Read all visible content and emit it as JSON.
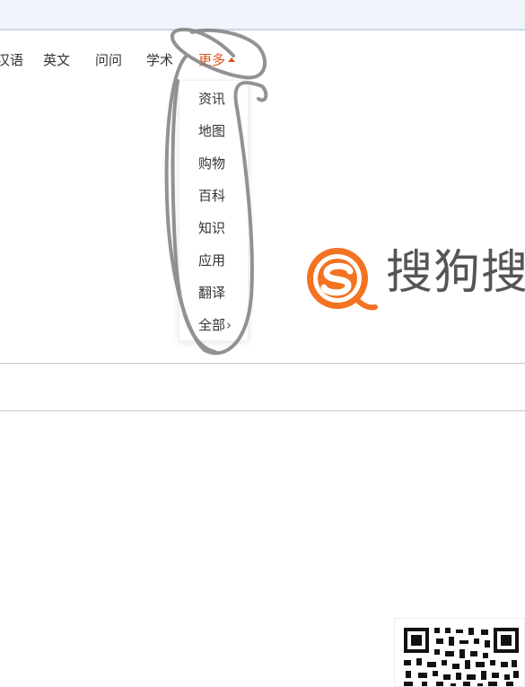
{
  "nav": {
    "items": [
      {
        "label": "汉语"
      },
      {
        "label": "英文"
      },
      {
        "label": "问问"
      },
      {
        "label": "学术"
      }
    ],
    "more": {
      "label": "更多",
      "expanded": true
    }
  },
  "dropdown": {
    "items": [
      {
        "label": "资讯"
      },
      {
        "label": "地图"
      },
      {
        "label": "购物"
      },
      {
        "label": "百科"
      },
      {
        "label": "知识"
      },
      {
        "label": "应用"
      },
      {
        "label": "翻译"
      },
      {
        "label": "全部"
      }
    ],
    "all_chevron": "chevron-right-icon"
  },
  "logo": {
    "text": "搜狗搜",
    "brand_color": "#f26a1b"
  },
  "search": {
    "value": "",
    "placeholder": ""
  },
  "qr": {
    "icon": "qr-code-icon"
  },
  "annotation": {
    "color": "#7f7f7f",
    "icon": "hand-drawn-circle"
  }
}
